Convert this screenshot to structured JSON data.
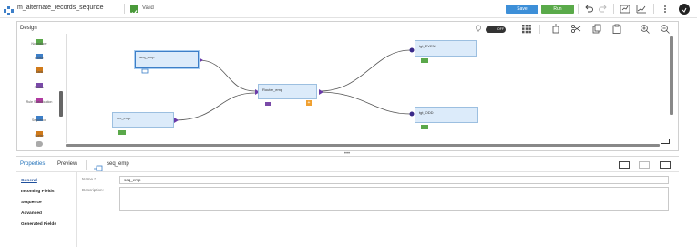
{
  "header": {
    "title": "m_alternate_records_sequnce",
    "status": "Valid",
    "save_label": "Save",
    "run_label": "Run"
  },
  "design": {
    "title": "Design",
    "toggle_label": "OFF",
    "palette": [
      {
        "label": "Normalizer",
        "icon": "normalizer-icon",
        "color": "#5aa84a"
      },
      {
        "label": "Parse",
        "icon": "parse-icon",
        "color": "#3d7fc8"
      },
      {
        "label": "Rank",
        "icon": "rank-icon",
        "color": "#d07a1a"
      },
      {
        "label": "Router",
        "icon": "router-icon",
        "color": "#7a4aa8"
      },
      {
        "label": "Rule Specification",
        "icon": "rule-specification-icon",
        "color": "#b03aa0"
      },
      {
        "label": "Sequence",
        "icon": "sequence-icon",
        "color": "#3d7fc8"
      },
      {
        "label": "Sorter",
        "icon": "sorter-icon",
        "color": "#d07a1a"
      }
    ],
    "nodes": {
      "seq": "seq_emp",
      "src": "src_emp",
      "router": "Router_emp",
      "even": "tgt_EVEN",
      "odd": "tgt_ODD"
    }
  },
  "properties": {
    "tabs": [
      "Properties",
      "Preview"
    ],
    "selected_object": "seq_emp",
    "nav": [
      "General",
      "Incoming Fields",
      "Sequence",
      "Advanced",
      "Generated Fields"
    ],
    "name_label": "Name *",
    "name_value": "seq_emp",
    "description_label": "Description:",
    "description_value": ""
  },
  "colors": {
    "accent": "#1e6fb8",
    "save": "#3d8fd8",
    "run": "#5aaa4a",
    "valid": "#4a9a3a",
    "node": "#dcebfa"
  }
}
